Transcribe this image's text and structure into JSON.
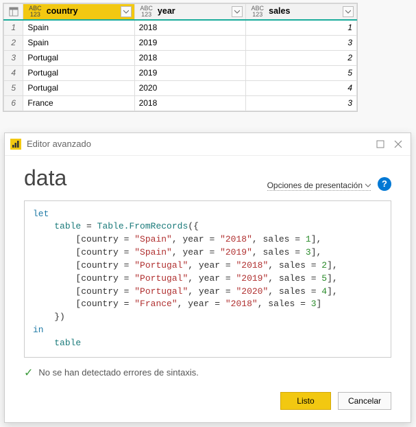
{
  "table": {
    "columns": [
      {
        "name": "country"
      },
      {
        "name": "year"
      },
      {
        "name": "sales"
      }
    ],
    "rows": [
      {
        "n": "1",
        "country": "Spain",
        "year": "2018",
        "sales": "1"
      },
      {
        "n": "2",
        "country": "Spain",
        "year": "2019",
        "sales": "3"
      },
      {
        "n": "3",
        "country": "Portugal",
        "year": "2018",
        "sales": "2"
      },
      {
        "n": "4",
        "country": "Portugal",
        "year": "2019",
        "sales": "5"
      },
      {
        "n": "5",
        "country": "Portugal",
        "year": "2020",
        "sales": "4"
      },
      {
        "n": "6",
        "country": "France",
        "year": "2018",
        "sales": "3"
      }
    ]
  },
  "dialog": {
    "title": "Editor avanzado",
    "query_name": "data",
    "presentation_options": "Opciones de presentación",
    "help": "?",
    "status": "No se han detectado errores de sintaxis.",
    "ok": "Listo",
    "cancel": "Cancelar",
    "code": {
      "let": "let",
      "tbl": "table",
      "eq": " = ",
      "fn": "Table.FromRecords",
      "open": "({",
      "rows": [
        {
          "k1": "country",
          "v1": "\"Spain\"",
          "k2": "year",
          "v2": "\"2018\"",
          "k3": "sales",
          "v3": "1",
          "t": "],"
        },
        {
          "k1": "country",
          "v1": "\"Spain\"",
          "k2": "year",
          "v2": "\"2019\"",
          "k3": "sales",
          "v3": "3",
          "t": "],"
        },
        {
          "k1": "country",
          "v1": "\"Portugal\"",
          "k2": "year",
          "v2": "\"2018\"",
          "k3": "sales",
          "v3": "2",
          "t": "],"
        },
        {
          "k1": "country",
          "v1": "\"Portugal\"",
          "k2": "year",
          "v2": "\"2019\"",
          "k3": "sales",
          "v3": "5",
          "t": "],"
        },
        {
          "k1": "country",
          "v1": "\"Portugal\"",
          "k2": "year",
          "v2": "\"2020\"",
          "k3": "sales",
          "v3": "4",
          "t": "],"
        },
        {
          "k1": "country",
          "v1": "\"France\"",
          "k2": "year",
          "v2": "\"2018\"",
          "k3": "sales",
          "v3": "3",
          "t": "]"
        }
      ],
      "close": "})",
      "in": "in",
      "out": "table"
    }
  }
}
